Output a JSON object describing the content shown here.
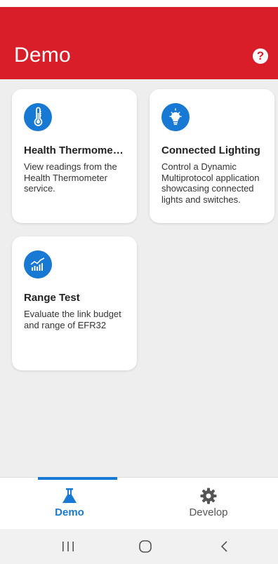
{
  "app_bar": {
    "title": "Demo",
    "help_icon": "help-circle-icon",
    "help_glyph": "?",
    "background": "#d91e2a"
  },
  "cards": [
    {
      "icon": "thermometer-icon",
      "title": "Health Thermometer",
      "description": "View readings from the Health Thermometer service."
    },
    {
      "icon": "lightbulb-icon",
      "title": "Connected Lighting",
      "description": "Control a Dynamic Multiprotocol application showcasing connected lights and switches."
    },
    {
      "icon": "range-chart-icon",
      "title": "Range Test",
      "description": "Evaluate the link budget and range of EFR32"
    }
  ],
  "bottom_nav": {
    "items": [
      {
        "label": "Demo",
        "icon": "flask-icon",
        "selected": true
      },
      {
        "label": "Develop",
        "icon": "gear-icon",
        "selected": false
      }
    ],
    "accent": "#1779d4"
  },
  "system_nav": {
    "buttons": [
      "recents-icon",
      "home-icon",
      "back-icon"
    ]
  }
}
